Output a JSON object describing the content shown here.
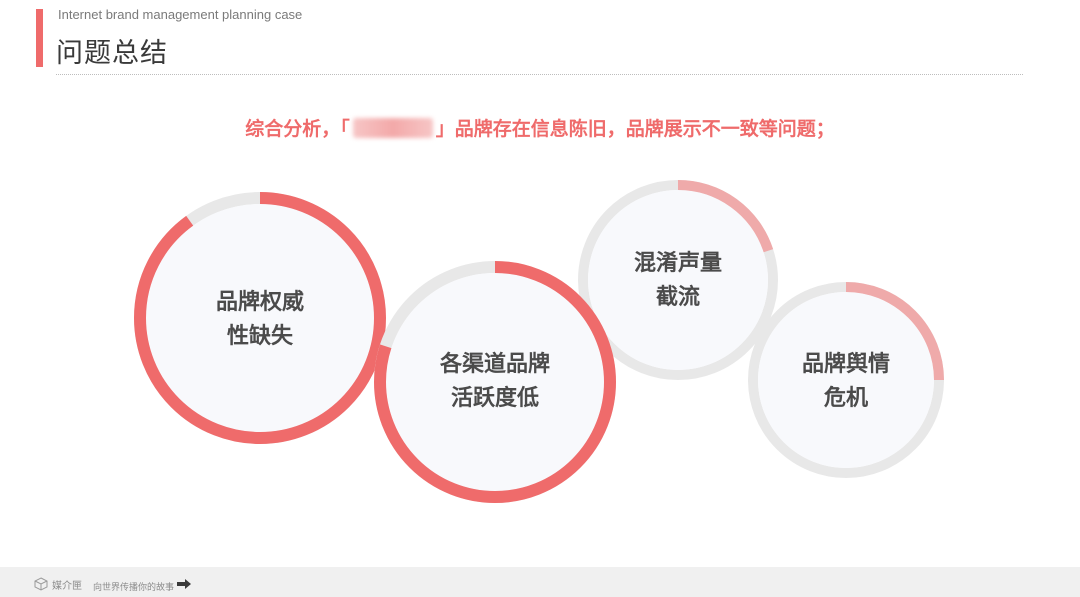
{
  "header": {
    "subtitle_en": "Internet brand management planning case",
    "title": "问题总结"
  },
  "summary": {
    "prefix": "综合分析，「",
    "suffix": "」品牌存在信息陈旧，品牌展示不一致等问题；"
  },
  "circles": [
    {
      "line1": "品牌权威",
      "line2": "性缺失",
      "progress": 0.9,
      "color": "#ef6b6b"
    },
    {
      "line1": "各渠道品牌",
      "line2": "活跃度低",
      "progress": 0.8,
      "color": "#ef6b6b"
    },
    {
      "line1": "混淆声量",
      "line2": "截流",
      "progress": 0.2,
      "color": "#efaaaa"
    },
    {
      "line1": "品牌舆情",
      "line2": "危机",
      "progress": 0.25,
      "color": "#efaaaa"
    }
  ],
  "footer": {
    "logo": "媒介匣",
    "slogan": "向世界传播你的故事"
  },
  "colors": {
    "accent": "#ef6b6b",
    "accent_light": "#efaaaa",
    "track": "#e8e8e8",
    "circle_fill": "#f8f9fc"
  }
}
